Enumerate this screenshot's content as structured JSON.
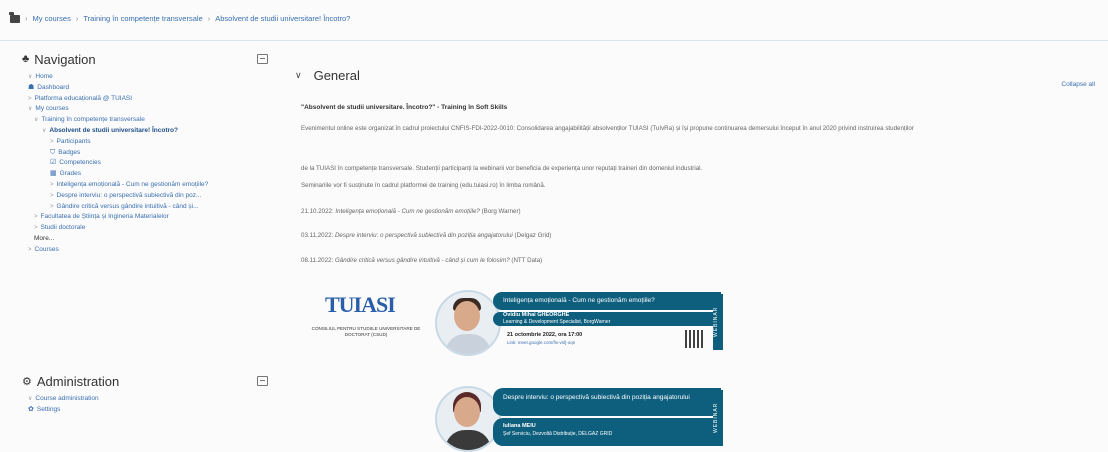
{
  "breadcrumb": [
    "My courses",
    "Training în competențe transversale",
    "Absolvent de studii universitare! Încotro?"
  ],
  "navigation": {
    "title": "Navigation",
    "items": [
      {
        "label": "Home",
        "level": 0,
        "chev": "∨"
      },
      {
        "label": "Dashboard",
        "level": 0,
        "icon": "dashboard-icon"
      },
      {
        "label": "Platforma educațională @ TUIASI",
        "level": 0,
        "chev": ">"
      },
      {
        "label": "My courses",
        "level": 0,
        "chev": "∨"
      },
      {
        "label": "Training în competențe transversale",
        "level": 1,
        "chev": "∨"
      },
      {
        "label": "Absolvent de studii universitare! Încotro?",
        "level": 2,
        "chev": "∨",
        "bold": true
      },
      {
        "label": "Participants",
        "level": 3,
        "chev": ">"
      },
      {
        "label": "Badges",
        "level": 3,
        "icon": "badge-icon"
      },
      {
        "label": "Competencies",
        "level": 3,
        "icon": "competencies-icon"
      },
      {
        "label": "Grades",
        "level": 3,
        "icon": "grades-icon"
      },
      {
        "label": "Inteligența emoțională - Cum ne gestionăm emoțiile?",
        "level": 3,
        "chev": ">"
      },
      {
        "label": "Despre interviu: o perspectivă subiectivă din poz...",
        "level": 3,
        "chev": ">"
      },
      {
        "label": "Gândire critică versus gândire intuitivă - când și...",
        "level": 3,
        "chev": ">"
      },
      {
        "label": "Facultatea de Știința și Ingineria Materialelor",
        "level": 1,
        "chev": ">"
      },
      {
        "label": "Studii doctorale",
        "level": 1,
        "chev": ">"
      },
      {
        "label": "More...",
        "level": 1,
        "dark": true
      },
      {
        "label": "Courses",
        "level": 0,
        "chev": ">"
      }
    ]
  },
  "administration": {
    "title": "Administration",
    "items": [
      {
        "label": "Course administration",
        "chev": "∨"
      },
      {
        "label": "Settings",
        "icon": "gear-icon"
      }
    ]
  },
  "main": {
    "section_title": "General",
    "collapse_all": "Collapse all",
    "course_title": "\"Absolvent de studii universitare. Încotro?\" - Training în Soft Skills",
    "p1": "Evenimentul online este organizat în cadrul proiectului CNFIS-FDI-2022-0010: Consolidarea angajabilității absolvenților TUIASI (TuIvRa) și își propune continuarea demersului început în anul 2020 privind instruirea studenților",
    "p2": "de la TUIASI în competențe transversale. Studenții participanți la webinarii vor beneficia de experiența unor reputați traineri din domeniul industrial.",
    "p3": "Seminariile vor fi susținute în cadrul platformei de training (edu.tuiasi.ro) în limba română.",
    "p4_date": "21.10.2022:",
    "p4_text": "Inteligența emoțională - Cum ne gestionăm emoțiile?",
    "p4_org": "(Borg Warner)",
    "p5_date": "03.11.2022:",
    "p5_text": "Despre interviu: o perspectivă subiectivă din poziția angajatorului",
    "p5_org": "(Delgaz Grid)",
    "p6_date": "08.11.2022:",
    "p6_text": "Gândire critică versus gândire intuitivă - când și cum le folosim?",
    "p6_org": "(NTT Data)"
  },
  "logo": {
    "text": "TUIASI",
    "subtitle": "CONSILIUL PENTRU STUDIILE UNIVERSITARE DE DOCTORAT (CSUD)"
  },
  "webinars": [
    {
      "title": "Inteligența emoțională - Cum ne gestionăm emoțiile?",
      "speaker": "Ovidiu Mihai GHEORGHE",
      "role": "Learning & Development Specialist, BorgWarner",
      "when": "21 octombrie 2022, ora 17:00",
      "link": "Link: meet.google.com/fix-vsfj-oqn",
      "tag": "WEBINAR"
    },
    {
      "title": "Despre interviu: o perspectivă subiectivă din poziția angajatorului",
      "speaker": "Iuliana MEIU",
      "role": "Șef Serviciu, Dezvoltă Distribuție, DELGAZ GRID",
      "when": "",
      "link": "",
      "tag": "WEBINAR"
    }
  ]
}
